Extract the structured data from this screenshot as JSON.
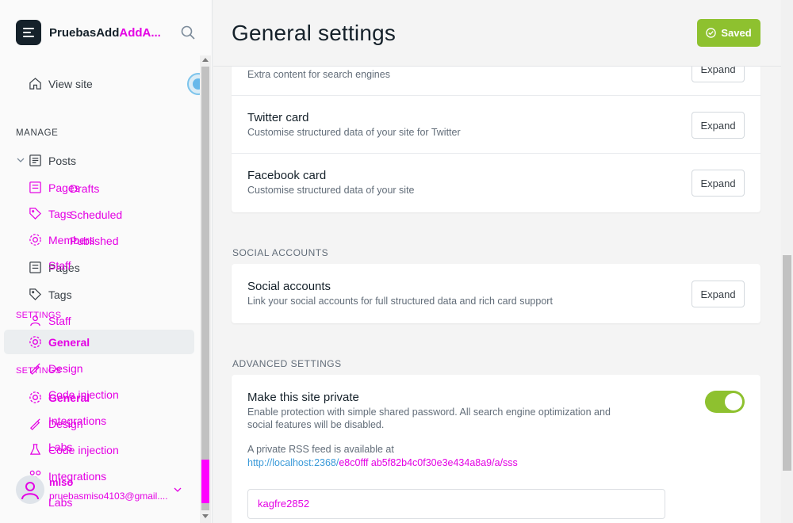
{
  "sidebar": {
    "brand_name": "PruebasAdd",
    "brand_name_highlight": "AddA...",
    "view_site": "View site",
    "manage_label": "MANAGE",
    "posts": "Posts",
    "pages": "Pages",
    "tags": "Tags",
    "staff": "Staff",
    "general": "General",
    "design": "Design",
    "code_injection": "Code injection",
    "integrations": "Integrations",
    "labs": "Labs",
    "settings_label": "SETTINGS",
    "ghost": {
      "drafts": "Drafts",
      "scheduled": "Scheduled",
      "published": "Published",
      "pages_a": "Pages",
      "tags_a": "Tags",
      "members": "Members",
      "staff_a": "Staff",
      "settings_a": "SETTINGS",
      "design_a": "Design",
      "code_injection_a": "Code injection",
      "integrations_a": "Integrations",
      "labs_a": "Labs",
      "settings_b": "SETTINGS",
      "general_b": "General",
      "design_b": "Design",
      "code_injection_b": "Code injection",
      "integrations_b": "Integrations",
      "labs_b": "Labs",
      "user_name": "miso",
      "user_email": "pruebasmiso4103@gmail...."
    }
  },
  "header": {
    "title": "General settings",
    "saved_label": "Saved"
  },
  "main": {
    "meta_desc": "Extra content for search engines",
    "twitter_title": "Twitter card",
    "twitter_desc": "Customise structured data of your site for Twitter",
    "facebook_title": "Facebook card",
    "facebook_desc": "Customise structured data of your site",
    "expand_label": "Expand",
    "social_group": "SOCIAL ACCOUNTS",
    "social_title": "Social accounts",
    "social_desc": "Link your social accounts for full structured data and rich card support",
    "advanced_group": "ADVANCED SETTINGS",
    "private_title": "Make this site private",
    "private_desc_1": "Enable protection with simple shared password. All search engine optimization and",
    "private_desc_2": "social features will be disabled.",
    "rss_label": "A private RSS feed is available at",
    "rss_link": "http://localhost:2368/",
    "rss_link_overlay": "e8c0fff ab5f82b4c0f30e3e434a8a9/a/sss",
    "password_value": "kagfre2852"
  },
  "colors": {
    "accent_green": "#8ec12f",
    "overlay_pink": "#e400e4",
    "link_blue": "#3a9ad9"
  }
}
